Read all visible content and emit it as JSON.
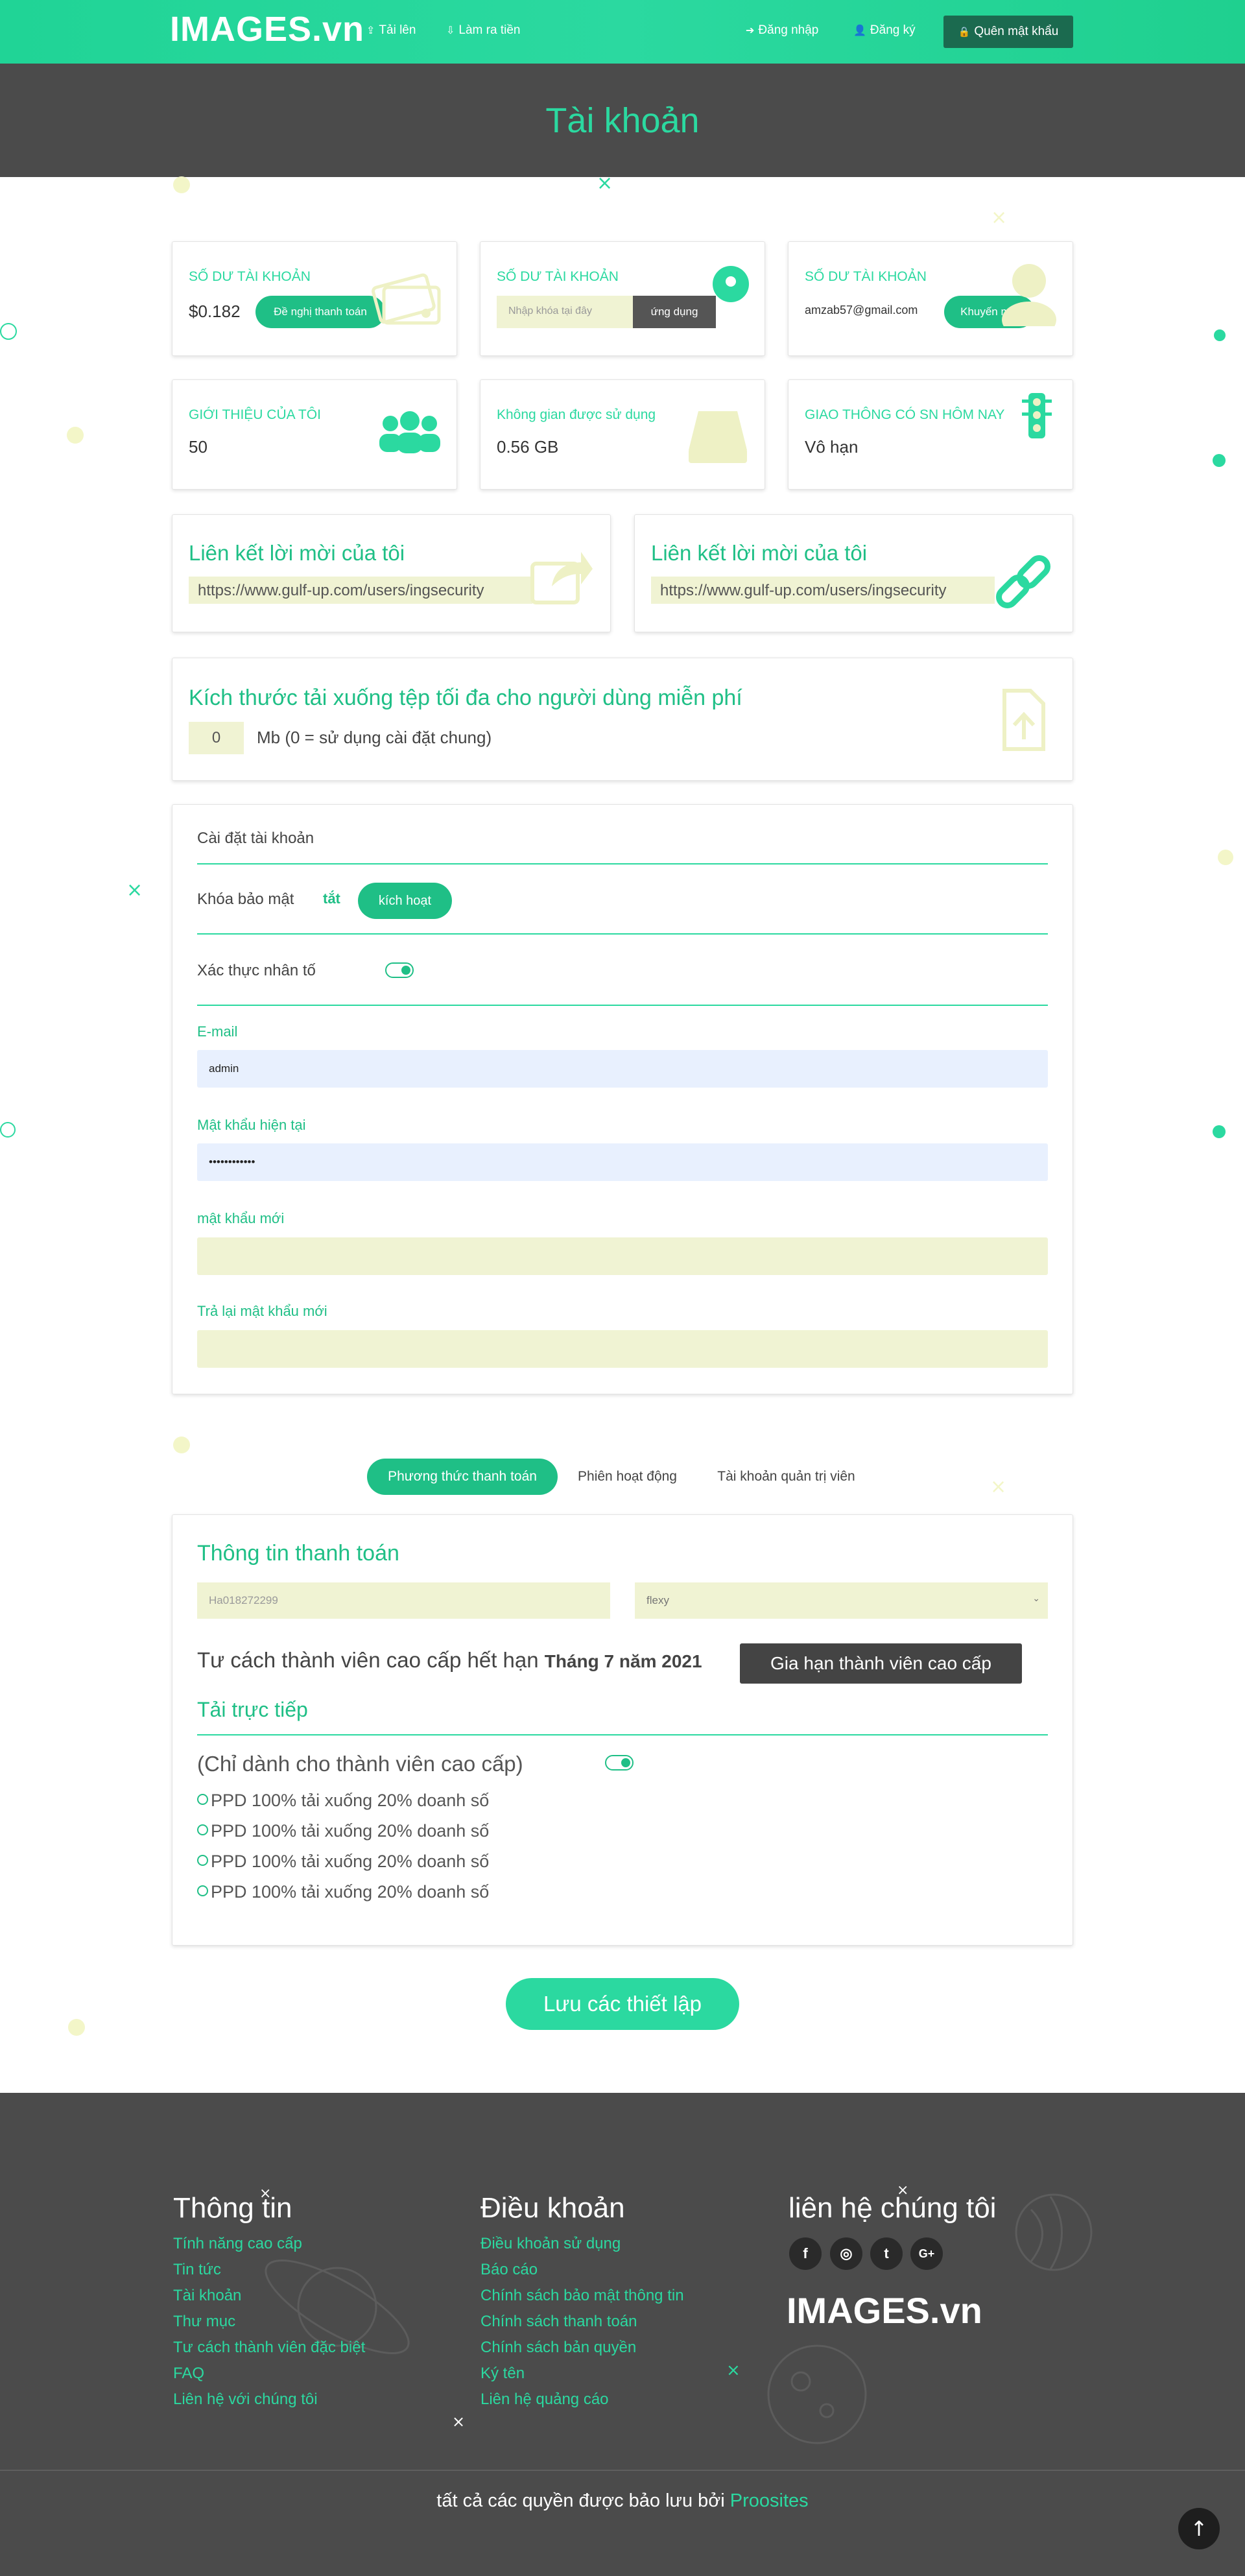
{
  "nav": {
    "logo": "IMAGES.vn",
    "upload": "Tải lên",
    "remote_upload": "Làm ra tiền",
    "login": "Đăng nhập",
    "register": "Đăng ký",
    "forgot": "Quên mật khẩu"
  },
  "page_title": "Tài khoản",
  "stats": {
    "balance1_label": "SỐ DƯ TÀI KHOẢN",
    "balance1_value": "$0.182",
    "balance1_button": "Đề nghị thanh toán",
    "balance2_label": "SỐ DƯ TÀI KHOẢN",
    "balance2_placeholder": "Nhập khóa tại đây",
    "balance2_button": "ứng dụng",
    "balance3_label": "SỐ DƯ TÀI KHOẢN",
    "balance3_value": "amzab57@gmail.com",
    "balance3_button": "Khuyến mại",
    "referral_label": "GIỚI THIỆU CỦA TÔI",
    "referral_value": "50",
    "space_label": "Không gian được sử dụng",
    "space_value": "0.56 GB",
    "traffic_label": "GIAO THÔNG CÓ SN HÔM NAY",
    "traffic_value": "Vô hạn"
  },
  "invite": {
    "title1": "Liên kết lời mời của tôi",
    "url1": "https://www.gulf-up.com/users/ingsecurity",
    "title2": "Liên kết lời mời của tôi",
    "url2": "https://www.gulf-up.com/users/ingsecurity"
  },
  "maxsize": {
    "title": "Kích thước tải xuống tệp tối đa cho người dùng miễn phí",
    "value": "0",
    "hint": "Mb (0 = sử dụng cài đặt chung)"
  },
  "settings": {
    "heading": "Cài đặt tài khoản",
    "security_lock": "Khóa bảo mật",
    "security_state": "tắt",
    "security_button": "kích hoạt",
    "two_factor": "Xác thực nhân tố",
    "email_label": "E-mail",
    "email_value": "admin",
    "current_pw_label": "Mật khẩu hiện tại",
    "current_pw_value": "••••••••••••",
    "new_pw_label": "mật khẩu mới",
    "confirm_pw_label": "Trả lại mật khẩu mới"
  },
  "tabs": {
    "payment": "Phương thức thanh toán",
    "sessions": "Phiên hoạt động",
    "admin": "Tài khoản quản trị viên"
  },
  "payment": {
    "title": "Thông tin thanh toán",
    "account_value": "Ha018272299",
    "method_value": "flexy",
    "premium_text": "Tư cách thành viên cao cấp hết hạn",
    "premium_date": "Tháng 7 năm 2021",
    "renew_button": "Gia hạn thành viên cao cấp",
    "direct_title": "Tải trực tiếp",
    "premium_only": "(Chỉ dành cho thành viên cao cấp)",
    "options": [
      "PPD 100% tải xuống 20% doanh số",
      "PPD 100% tải xuống 20% doanh số",
      "PPD 100% tải xuống 20% doanh số",
      "PPD 100% tải xuống 20% doanh số"
    ]
  },
  "save_button": "Lưu các thiết lập",
  "footer": {
    "info_title": "Thông tin",
    "info_links": [
      "Tính năng cao cấp",
      "Tin tức",
      "Tài khoản",
      "Thư mục",
      "Tư cách thành viên đặc biệt",
      "FAQ",
      "Liên hệ với chúng tôi"
    ],
    "terms_title": "Điều khoản",
    "terms_links": [
      "Điều khoản sử dụng",
      "Báo cáo",
      "Chính sách bảo mật thông tin",
      "Chính sách thanh toán",
      "Chính sách bản quyền",
      "Ký tên",
      "Liên hệ quảng cáo"
    ],
    "contact_title": "liên hệ chúng tôi",
    "logo": "IMAGES.vn",
    "social": [
      "f",
      "◎",
      "t",
      "G+"
    ],
    "copyright": "tất cả các quyền được bảo lưu bởi",
    "brand": "Proosites"
  },
  "colors": {
    "accent": "#2bd9a0",
    "dark": "#4b4b4b",
    "input_bg": "#f0f3d3",
    "email_bg": "#e8f0fe"
  }
}
